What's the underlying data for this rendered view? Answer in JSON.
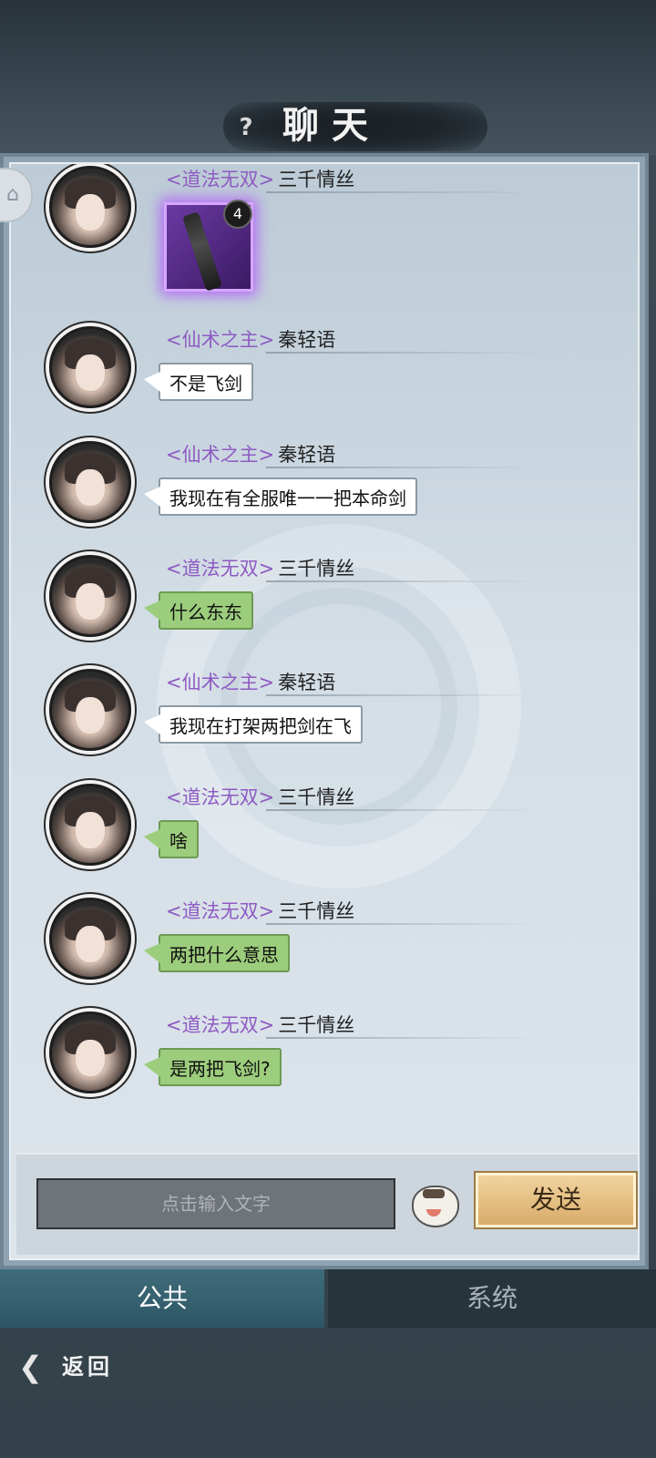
{
  "header": {
    "title": "聊天",
    "help_icon": "question-mark-icon"
  },
  "messages": [
    {
      "guild": "<道法无双>",
      "player": "三千情丝",
      "type": "item",
      "item_count": "4",
      "item_icon": "sword-item-icon"
    },
    {
      "guild": "<仙术之主>",
      "player": "秦轻语",
      "type": "text",
      "bubble": "white",
      "text": "不是飞剑"
    },
    {
      "guild": "<仙术之主>",
      "player": "秦轻语",
      "type": "text",
      "bubble": "white",
      "text": "我现在有全服唯一一把本命剑"
    },
    {
      "guild": "<道法无双>",
      "player": "三千情丝",
      "type": "text",
      "bubble": "green",
      "text": "什么东东"
    },
    {
      "guild": "<仙术之主>",
      "player": "秦轻语",
      "type": "text",
      "bubble": "white",
      "text": "我现在打架两把剑在飞"
    },
    {
      "guild": "<道法无双>",
      "player": "三千情丝",
      "type": "text",
      "bubble": "green",
      "text": "啥"
    },
    {
      "guild": "<道法无双>",
      "player": "三千情丝",
      "type": "text",
      "bubble": "green",
      "text": "两把什么意思"
    },
    {
      "guild": "<道法无双>",
      "player": "三千情丝",
      "type": "text",
      "bubble": "green",
      "text": "是两把飞剑?"
    }
  ],
  "input": {
    "placeholder": "点击输入文字",
    "emoji_icon": "tiger-emoji-icon",
    "send_label": "发送"
  },
  "tabs": [
    {
      "label": "公共",
      "active": true
    },
    {
      "label": "系统",
      "active": false
    }
  ],
  "footer": {
    "back_label": "返回",
    "back_icon": "back-arrow-icon"
  },
  "colors": {
    "guild_name": "#8e5bc3",
    "green_bubble": "#9ccd7c",
    "send_button": "#d9ac6a",
    "item_glow": "#b26bf5"
  }
}
